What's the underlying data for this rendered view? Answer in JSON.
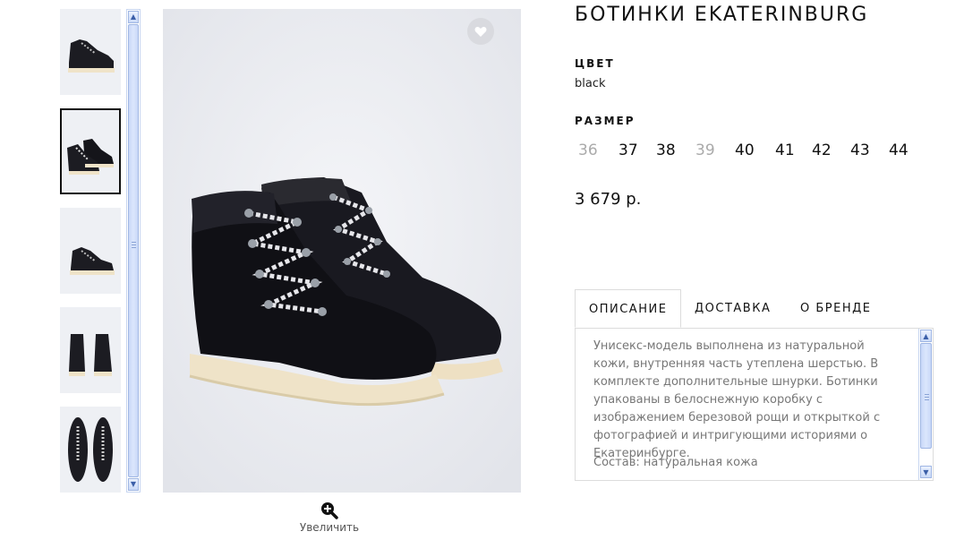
{
  "product": {
    "title": "БОТИНКИ EKATERINBURG",
    "color_label": "ЦВЕТ",
    "color_value": "black",
    "size_label": "РАЗМЕР",
    "sizes": [
      {
        "label": "36",
        "available": false
      },
      {
        "label": "37",
        "available": true
      },
      {
        "label": "38",
        "available": true
      },
      {
        "label": "39",
        "available": false
      },
      {
        "label": "40",
        "available": true
      },
      {
        "label": "41",
        "available": true
      },
      {
        "label": "42",
        "available": true
      },
      {
        "label": "43",
        "available": true
      },
      {
        "label": "44",
        "available": true
      }
    ],
    "price": "3 679 р."
  },
  "gallery": {
    "selected_index": 1,
    "thumbnail_views": [
      "side",
      "pair-angle",
      "side-low",
      "back",
      "top"
    ],
    "zoom_label": "Увеличить"
  },
  "tabs": {
    "items": [
      "ОПИСАНИЕ",
      "ДОСТАВКА",
      "О БРЕНДЕ"
    ],
    "active_index": 0,
    "description": "Унисекс-модель выполнена из натуральной кожи, внутренняя часть утеплена шерстью. В комплекте дополнительные шнурки. Ботинки упакованы в белоснежную коробку с изображением березовой рощи и открыткой с фотографией и интригующими историями о Екатеринбурге.",
    "composition": "Состав: натуральная кожа"
  },
  "icons": {
    "favorite": "heart-icon",
    "zoom": "zoom-in-icon",
    "scroll_up": "scroll-up-arrow-icon",
    "scroll_down": "scroll-down-arrow-icon"
  },
  "colors": {
    "accent": "#111111",
    "unavailable_size": "#aaaaaa",
    "scrollbar": "#c9d8f8",
    "image_bg": "#eceef2",
    "sole": "#efe3c8"
  }
}
